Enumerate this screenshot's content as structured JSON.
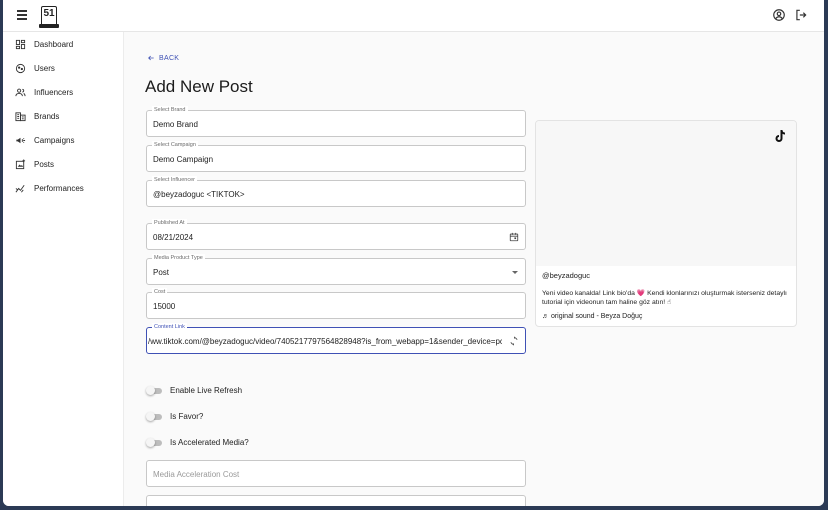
{
  "appbar": {
    "logo_text": "51",
    "icons": [
      "menu-icon",
      "account-circle-icon",
      "logout-icon"
    ]
  },
  "sidebar": {
    "items": [
      {
        "label": "Dashboard",
        "icon": "dashboard-icon"
      },
      {
        "label": "Users",
        "icon": "users-icon"
      },
      {
        "label": "Influencers",
        "icon": "influencers-icon"
      },
      {
        "label": "Brands",
        "icon": "brands-icon"
      },
      {
        "label": "Campaigns",
        "icon": "campaigns-icon"
      },
      {
        "label": "Posts",
        "icon": "posts-icon"
      },
      {
        "label": "Performances",
        "icon": "performances-icon"
      }
    ]
  },
  "page": {
    "back_label": "BACK",
    "title": "Add New Post"
  },
  "form": {
    "brand": {
      "label": "Select Brand",
      "value": "Demo Brand"
    },
    "campaign": {
      "label": "Select Campaign",
      "value": "Demo Campaign"
    },
    "influencer": {
      "label": "Select Influencer",
      "value": "@beyzadoguc <TIKTOK>"
    },
    "published_at": {
      "label": "Published At",
      "value": "08/21/2024"
    },
    "media_product_type": {
      "label": "Media Product Type",
      "value": "Post"
    },
    "cost": {
      "label": "Cost",
      "value": "15000"
    },
    "content_link": {
      "label": "Content Link",
      "value": "/ww.tiktok.com/@beyzadoguc/video/7405217797564828948?is_from_webapp=1&sender_device=pc"
    },
    "toggles": {
      "live_refresh": {
        "label": "Enable Live Refresh",
        "on": false
      },
      "is_favor": {
        "label": "Is Favor?",
        "on": false
      },
      "accelerated": {
        "label": "Is Accelerated Media?",
        "on": false
      }
    },
    "acceleration_cost": {
      "placeholder": "Media Acceleration Cost"
    }
  },
  "preview": {
    "username": "@beyzadoguc",
    "caption": "Yeni video kanalda! Link bio'da 💗 Kendi klonlarınızı oluşturmak isterseniz detaylı tutorial için videonun tam haline göz atın! ☝",
    "sound": "♬ original sound - Beyza Doğuç"
  },
  "colors": {
    "accent": "#3f51b5",
    "background": "#fafafa",
    "frame": "#2b3a55"
  }
}
